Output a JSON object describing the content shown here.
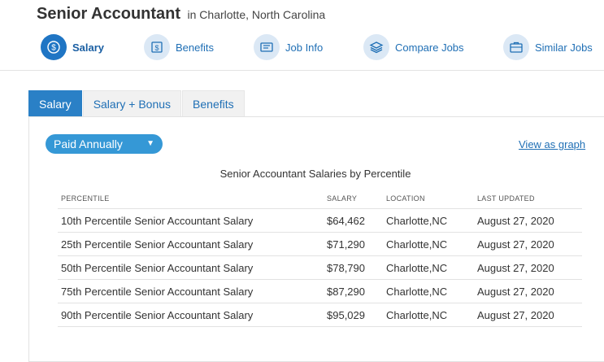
{
  "header": {
    "job_title": "Senior Accountant",
    "location": "in Charlotte, North Carolina"
  },
  "nav": [
    {
      "label": "Salary",
      "icon": "dollar-icon",
      "active": true
    },
    {
      "label": "Benefits",
      "icon": "benefits-icon"
    },
    {
      "label": "Job Info",
      "icon": "job-info-icon"
    },
    {
      "label": "Compare Jobs",
      "icon": "layers-icon"
    },
    {
      "label": "Similar Jobs",
      "icon": "briefcase-icon"
    }
  ],
  "tabs": [
    {
      "label": "Salary",
      "active": true
    },
    {
      "label": "Salary + Bonus"
    },
    {
      "label": "Benefits"
    }
  ],
  "pay_frequency": {
    "selected": "Paid Annually"
  },
  "graph_link": "View as graph",
  "table": {
    "title": "Senior Accountant Salaries by Percentile",
    "columns": [
      "PERCENTILE",
      "SALARY",
      "LOCATION",
      "LAST UPDATED"
    ],
    "rows": [
      [
        "10th Percentile Senior Accountant Salary",
        "$64,462",
        "Charlotte,NC",
        "August 27, 2020"
      ],
      [
        "25th Percentile Senior Accountant Salary",
        "$71,290",
        "Charlotte,NC",
        "August 27, 2020"
      ],
      [
        "50th Percentile Senior Accountant Salary",
        "$78,790",
        "Charlotte,NC",
        "August 27, 2020"
      ],
      [
        "75th Percentile Senior Accountant Salary",
        "$87,290",
        "Charlotte,NC",
        "August 27, 2020"
      ],
      [
        "90th Percentile Senior Accountant Salary",
        "$95,029",
        "Charlotte,NC",
        "August 27, 2020"
      ]
    ]
  },
  "colors": {
    "accent": "#1f75c4",
    "dropdown": "#3598d6",
    "link": "#1f6fb5"
  }
}
